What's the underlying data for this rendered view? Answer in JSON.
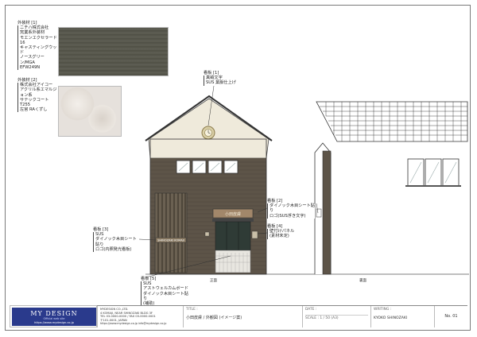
{
  "materials": [
    {
      "title": "外装材 [1]",
      "lines": [
        "ニチハ株式会社",
        "窯業系外装材",
        "モエンエクセラード16",
        "キャスティングウッド",
        "ノースグリーン/MGA",
        "EFW249N"
      ],
      "swatch_color": "#5a5a4f"
    },
    {
      "title": "外装材 [2]",
      "lines": [
        "株式会社アイコー",
        "アクリル系エマルジョン系",
        "サテックコート",
        "T255",
        "左官  RAくずし"
      ],
      "swatch_color": "#e6e1dc"
    }
  ],
  "signs": [
    {
      "title": "看板 [1]",
      "lines": [
        "真鍮文字",
        "SUS 葉脈仕上げ"
      ]
    },
    {
      "title": "看板 [2]",
      "lines": [
        "ダイノック木目シート貼り",
        "ロゴ(SUS浮き文字)"
      ]
    },
    {
      "title": "看板 [3]",
      "lines": [
        "SUS",
        "ダイノック木目シート貼り",
        "ロゴ(内照発光看板)"
      ]
    },
    {
      "title": "看板 [4]",
      "lines": [
        "壁付けパネル",
        "(素材未定)"
      ]
    },
    {
      "title": "看板 [5]",
      "lines": [
        "SUS",
        "アストウェルカムボード",
        "ダイノック木目シート貼り",
        "(補助)"
      ]
    }
  ],
  "building": {
    "sign_text": "小田皮膚",
    "panel_text": "SHINOZAKI KOMAJI",
    "ground_left": "正面",
    "ground_right": "裏面"
  },
  "titleblock": {
    "company": "MY DESIGN",
    "company_sub": "Official web site",
    "company_url": "https://www.mydesign.co.jp",
    "office_lines": [
      "MYDESIGN CO.,LTD.",
      "4 KOMAJI, NEAR SHINOZAKI BLDG 3F",
      "TEL 03-0000-0000 / FAX 03-0000-0001",
      "〒101-0001, JAPAN"
    ],
    "office_contact": "https://www.mydesign.co.jp   info@mydesign.co.jp",
    "title_label": "TITLE :",
    "title_value": "小田皮膚 / 外観図 (イメージ案)",
    "date_label": "DATE :",
    "date_value": "",
    "scale_label": "SCALE : 1 / 50 (A3)",
    "writing_label": "WRITING :",
    "writing_value": "KYOKO SHINOZAKI",
    "sheet_no": "No. 01"
  },
  "colors": {
    "wood_dark": "#5d5448",
    "stucco": "#efeadb",
    "roof": "#3a3a3a",
    "brand": "#2a3a8c"
  }
}
